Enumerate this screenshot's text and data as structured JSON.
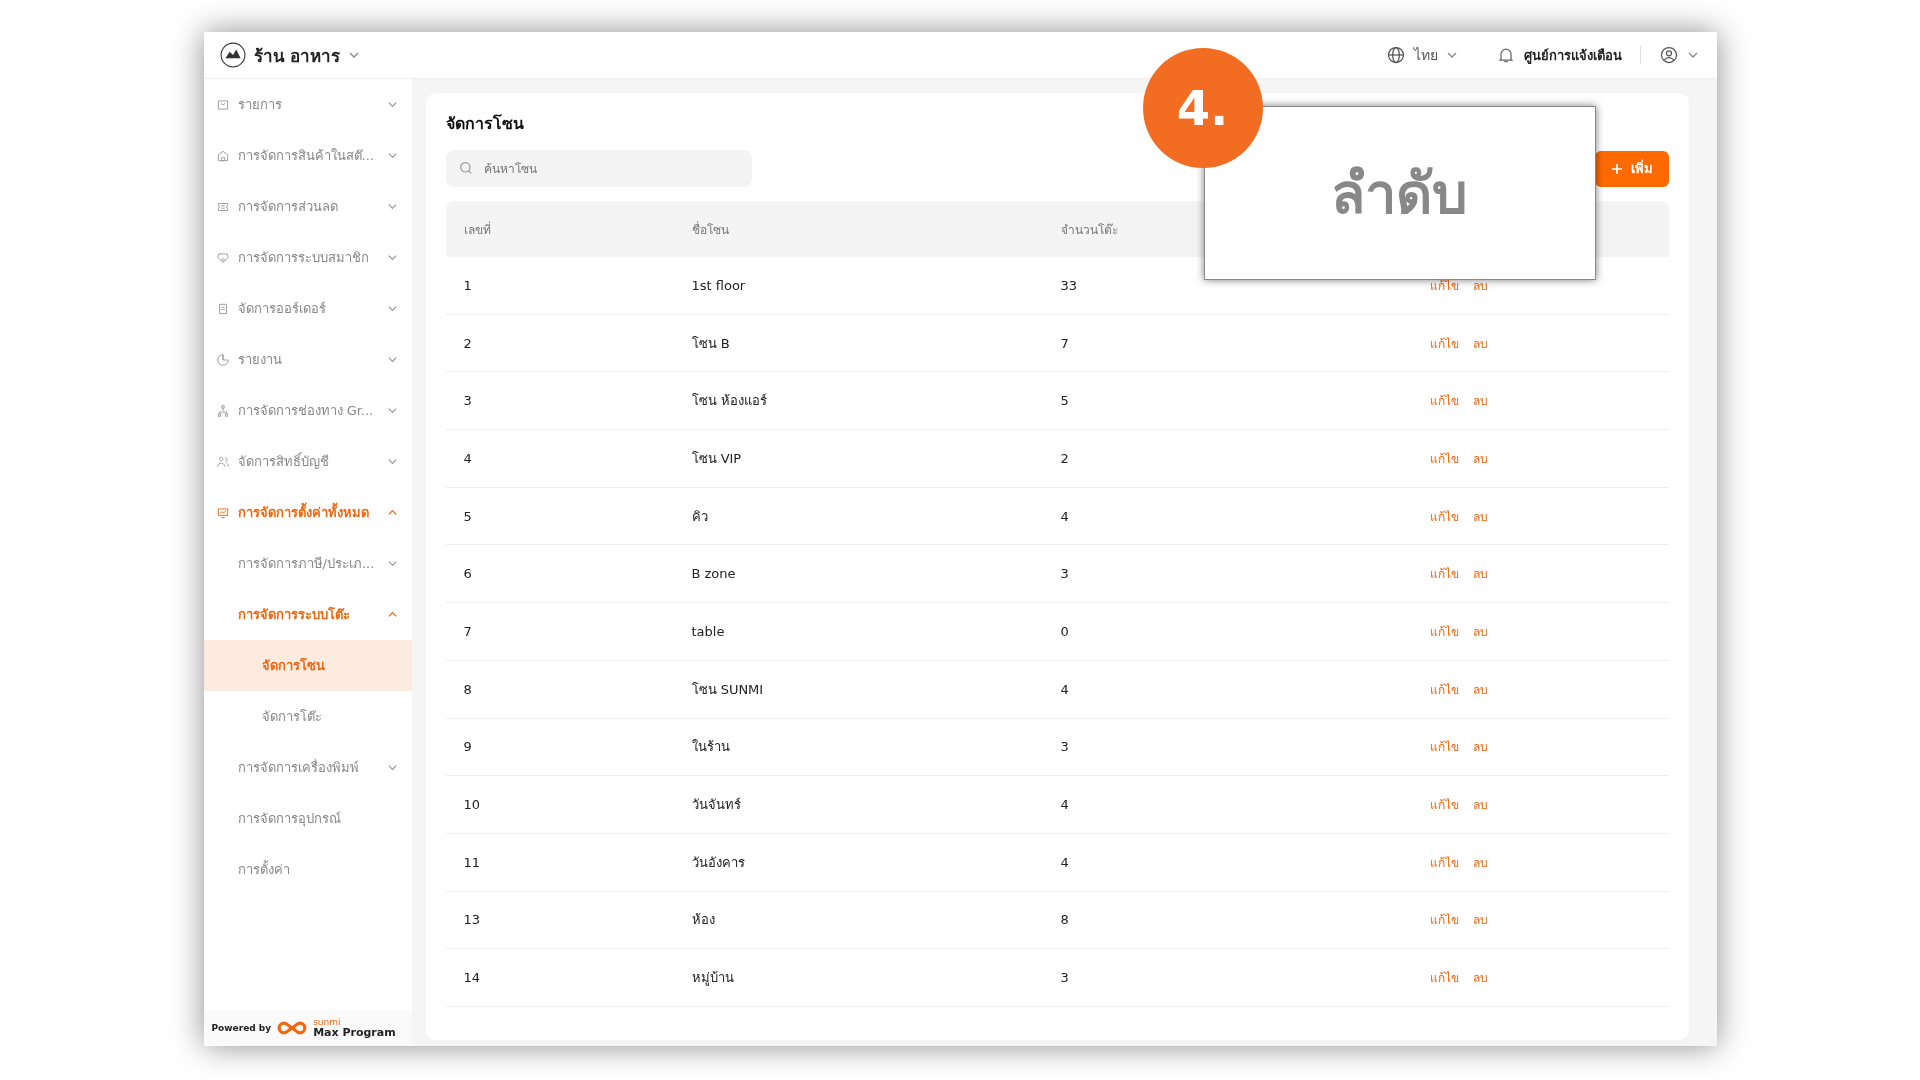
{
  "header": {
    "store_name": "ร้าน อาหาร",
    "language": "ไทย",
    "notifications": "ศูนย์การแจ้งเตือน"
  },
  "sidebar": {
    "items": [
      {
        "kind": "group",
        "label": "รายการ",
        "expanded": false
      },
      {
        "kind": "group",
        "label": "การจัดการสินค้าในสต๊...",
        "expanded": false
      },
      {
        "kind": "group",
        "label": "การจัดการส่วนลด",
        "expanded": false
      },
      {
        "kind": "group",
        "label": "การจัดการระบบสมาชิก",
        "expanded": false
      },
      {
        "kind": "group",
        "label": "จัดการออร์เดอร์",
        "expanded": false
      },
      {
        "kind": "group",
        "label": "รายงาน",
        "expanded": false
      },
      {
        "kind": "group",
        "label": "การจัดการช่องทาง Gr...",
        "expanded": false
      },
      {
        "kind": "group",
        "label": "จัดการสิทธิ์บัญชี",
        "expanded": false
      },
      {
        "kind": "group",
        "label": "การจัดการตั้งค่าทั้งหมด",
        "expanded": true,
        "children": [
          {
            "kind": "group",
            "label": "การจัดการภาษี/ประเภ...",
            "expanded": false
          },
          {
            "kind": "group",
            "label": "การจัดการระบบโต๊ะ",
            "expanded": true,
            "children": [
              {
                "kind": "link",
                "label": "จัดการโซน",
                "selected": true
              },
              {
                "kind": "link",
                "label": "จัดการโต๊ะ",
                "selected": false
              }
            ]
          },
          {
            "kind": "group",
            "label": "การจัดการเครื่องพิมพ์",
            "expanded": false
          },
          {
            "kind": "link",
            "label": "การจัดการอุปกรณ์",
            "selected": false
          },
          {
            "kind": "link",
            "label": "การตั้งค่า",
            "selected": false
          }
        ]
      }
    ],
    "footer": {
      "powered_by": "Powered by",
      "brand_small": "sunmi",
      "brand": "Max Program"
    }
  },
  "page": {
    "title": "จัดการโซน",
    "search": {
      "placeholder": "ค้นหาโซน"
    },
    "add_button": "เพิ่ม"
  },
  "table": {
    "columns": [
      "เลขที่",
      "ชื่อโซน",
      "จำนวนโต๊ะ"
    ],
    "rows": [
      {
        "number": "1",
        "name": "1st floor",
        "tables": "33",
        "edit": "แก้ไข",
        "delete": "ลบ"
      },
      {
        "number": "2",
        "name": "โซน B",
        "tables": "7",
        "edit": "แก้ไข",
        "delete": "ลบ"
      },
      {
        "number": "3",
        "name": "โซน ห้องแอร์",
        "tables": "5",
        "edit": "แก้ไข",
        "delete": "ลบ"
      },
      {
        "number": "4",
        "name": "โซน VIP",
        "tables": "2",
        "edit": "แก้ไข",
        "delete": "ลบ"
      },
      {
        "number": "5",
        "name": "คิว",
        "tables": "4",
        "edit": "แก้ไข",
        "delete": "ลบ"
      },
      {
        "number": "6",
        "name": "B zone",
        "tables": "3",
        "edit": "แก้ไข",
        "delete": "ลบ"
      },
      {
        "number": "7",
        "name": "table",
        "tables": "0",
        "edit": "แก้ไข",
        "delete": "ลบ"
      },
      {
        "number": "8",
        "name": "โซน SUNMI",
        "tables": "4",
        "edit": "แก้ไข",
        "delete": "ลบ"
      },
      {
        "number": "9",
        "name": "ในร้าน",
        "tables": "3",
        "edit": "แก้ไข",
        "delete": "ลบ"
      },
      {
        "number": "10",
        "name": "วันจันทร์",
        "tables": "4",
        "edit": "แก้ไข",
        "delete": "ลบ"
      },
      {
        "number": "11",
        "name": "วันอังคาร",
        "tables": "4",
        "edit": "แก้ไข",
        "delete": "ลบ"
      },
      {
        "number": "13",
        "name": "ห้อง",
        "tables": "8",
        "edit": "แก้ไข",
        "delete": "ลบ"
      },
      {
        "number": "14",
        "name": "หมู่บ้าน",
        "tables": "3",
        "edit": "แก้ไข",
        "delete": "ลบ"
      }
    ]
  },
  "callout": {
    "number": "4.",
    "text": "ลำดับ"
  }
}
